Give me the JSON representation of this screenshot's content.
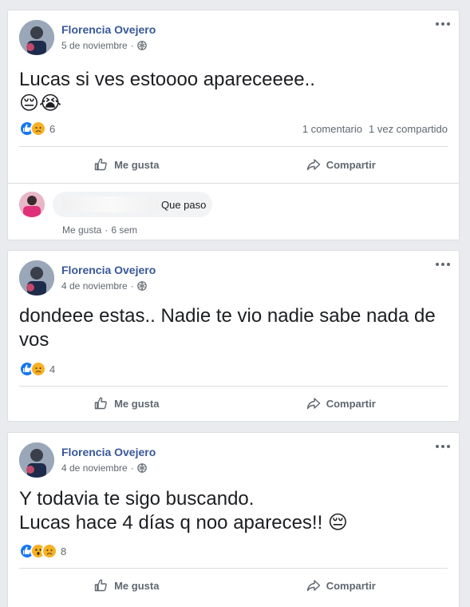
{
  "colors": {
    "link": "#385898",
    "like_blue": "#1877f2",
    "sad_yellow": "#f7b125"
  },
  "posts": [
    {
      "author": "Florencia Ovejero",
      "date": "5 de noviembre",
      "text_lines": [
        "Lucas si ves estoooo apareceeee..",
        "😔😭"
      ],
      "reactions": [
        "like-icon",
        "sad-icon"
      ],
      "reaction_count": "6",
      "comments_label": "1 comentario",
      "shares_label": "1 vez compartido",
      "like_label": "Me gusta",
      "share_label": "Compartir",
      "comment": {
        "text": "Que paso",
        "like_label": "Me gusta",
        "time": "6 sem"
      }
    },
    {
      "author": "Florencia Ovejero",
      "date": "4 de noviembre",
      "text_lines": [
        "dondeee estas.. Nadie te vio nadie sabe nada de vos"
      ],
      "reactions": [
        "like-icon",
        "sad-icon"
      ],
      "reaction_count": "4",
      "like_label": "Me gusta",
      "share_label": "Compartir"
    },
    {
      "author": "Florencia Ovejero",
      "date": "4 de noviembre",
      "text_lines": [
        "Y todavia te sigo buscando.",
        "Lucas hace 4 días q noo apareces!! 😔"
      ],
      "reactions": [
        "like-icon",
        "wow-icon",
        "sad-icon"
      ],
      "reaction_count": "8",
      "like_label": "Me gusta",
      "share_label": "Compartir"
    }
  ]
}
